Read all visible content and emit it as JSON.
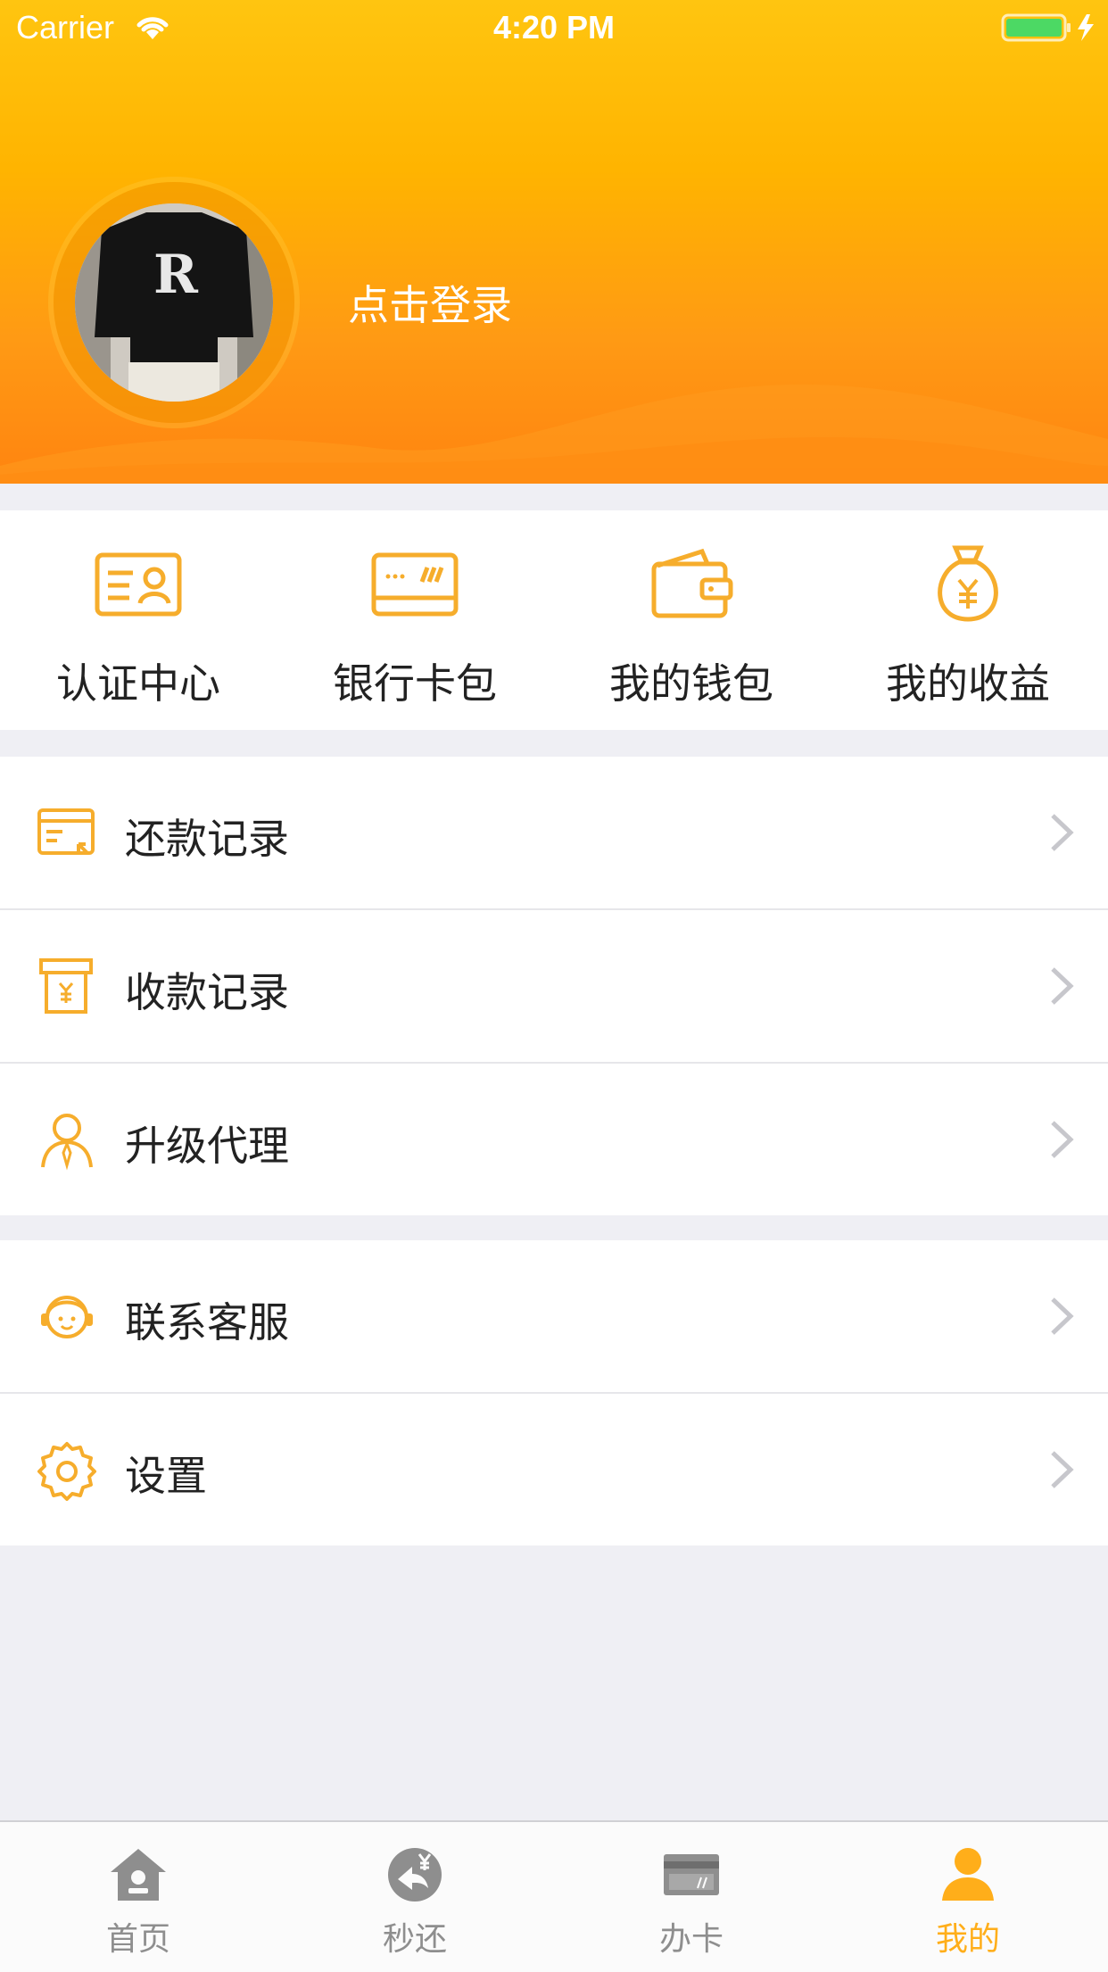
{
  "status_bar": {
    "carrier": "Carrier",
    "time": "4:20 PM"
  },
  "header": {
    "login_text": "点击登录"
  },
  "quick_actions": [
    {
      "label": "认证中心",
      "icon": "id-card-icon"
    },
    {
      "label": "银行卡包",
      "icon": "bank-card-icon"
    },
    {
      "label": "我的钱包",
      "icon": "wallet-icon"
    },
    {
      "label": "我的收益",
      "icon": "money-bag-icon"
    }
  ],
  "menu_group_1": [
    {
      "label": "还款记录",
      "icon": "repayment-record-icon"
    },
    {
      "label": "收款记录",
      "icon": "receipt-record-icon"
    },
    {
      "label": "升级代理",
      "icon": "agent-icon"
    }
  ],
  "menu_group_2": [
    {
      "label": "联系客服",
      "icon": "customer-service-icon"
    },
    {
      "label": "设置",
      "icon": "gear-icon"
    }
  ],
  "tab_bar": [
    {
      "label": "首页",
      "icon": "home-icon",
      "active": false
    },
    {
      "label": "秒还",
      "icon": "quick-repay-icon",
      "active": false
    },
    {
      "label": "办卡",
      "icon": "card-apply-icon",
      "active": false
    },
    {
      "label": "我的",
      "icon": "profile-icon",
      "active": true
    }
  ],
  "colors": {
    "accent": "#ffae1a",
    "header_top": "#ffc510",
    "header_bottom": "#ff8410",
    "background": "#efeff4"
  }
}
